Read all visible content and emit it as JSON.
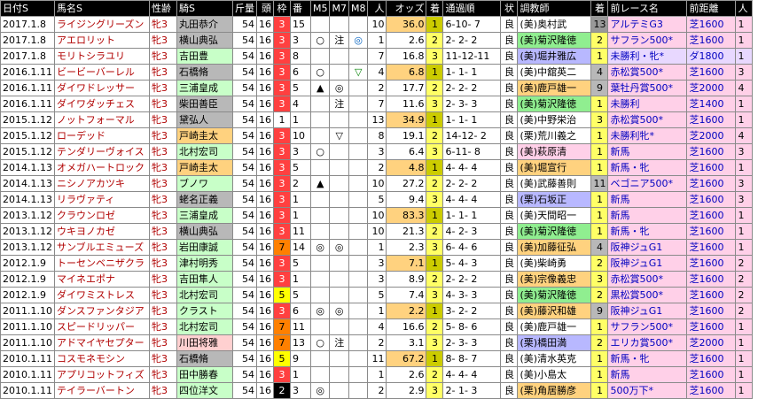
{
  "headers": {
    "date": "日付S",
    "horse": "馬名S",
    "sex": "性齢",
    "jockey": "騎S",
    "weight": "斤量",
    "heads": "頭",
    "frame": "枠",
    "num": "番",
    "m5": "M5",
    "m7": "M7",
    "m8": "M8",
    "pop": "人",
    "odds": "オッズ",
    "fin": "着",
    "passing": "通過順",
    "cond": "状",
    "trainer": "調教師",
    "prev_fin": "着",
    "prev_race": "前レース名",
    "prev_dist": "前距離",
    "prev_pop": "人"
  },
  "rows": [
    {
      "date": "2017.1.8",
      "horse": "ライジングリーズン",
      "sex": "牝3",
      "jockey": "丸田恭介",
      "jockey_bg": "#b8b8b8",
      "weight": "54",
      "heads": "16",
      "frame": "3",
      "frame_bg": "#ff4040",
      "frame_fg": "#fff",
      "num": "15",
      "m5": "",
      "m7": "",
      "m8": "",
      "m8_color": "",
      "pop": "10",
      "odds": "36.0",
      "fin": "1",
      "fin_class": "fin-win",
      "passing": "6-10- 7",
      "cond": "良",
      "trainer": "(美)奥村武",
      "trainer_bg": "",
      "prev_fin": "13",
      "prev_fin_bg": "#999",
      "prev_race": "アルテミG3",
      "prev_dist": "芝1600",
      "prev_pop": "1",
      "prev_bg": "prev-pink"
    },
    {
      "date": "2017.1.8",
      "horse": "アエロリット",
      "sex": "牝3",
      "jockey": "横山典弘",
      "jockey_bg": "#b8b8b8",
      "weight": "54",
      "heads": "16",
      "frame": "3",
      "frame_bg": "#ff4040",
      "frame_fg": "#fff",
      "num": "3",
      "m5": "○",
      "m7": "注",
      "m8": "◎",
      "m8_color": "#0060c0",
      "pop": "1",
      "odds": "2.6",
      "fin": "2",
      "fin_class": "fin-place",
      "passing": "2- 2- 2",
      "cond": "良",
      "trainer": "(美)菊沢隆徳",
      "trainer_bg": "#90ee90",
      "prev_fin": "2",
      "prev_fin_bg": "#ffff66",
      "prev_race": "サフラン500*",
      "prev_dist": "芝1600",
      "prev_pop": "1",
      "prev_bg": "prev-pink"
    },
    {
      "date": "2017.1.8",
      "horse": "モリトシラユリ",
      "sex": "牝3",
      "jockey": "吉田豊",
      "jockey_bg": "#c8ffc8",
      "weight": "54",
      "heads": "16",
      "frame": "3",
      "frame_bg": "#ff4040",
      "frame_fg": "#fff",
      "num": "8",
      "m5": "",
      "m7": "",
      "m8": "",
      "m8_color": "",
      "pop": "7",
      "odds": "16.8",
      "fin": "3",
      "fin_class": "fin-place",
      "passing": "11-12-11",
      "cond": "良",
      "trainer": "(美)堀井雅広",
      "trainer_bg": "#b8b8ff",
      "prev_fin": "1",
      "prev_fin_bg": "#ffff66",
      "prev_race": "未勝利・牝*",
      "prev_dist": "ダ1800",
      "prev_pop": "1",
      "prev_bg": "prev-lav"
    },
    {
      "date": "2016.1.11",
      "horse": "ビービーバーレル",
      "sex": "牝3",
      "jockey": "石橋脩",
      "jockey_bg": "#b8b8b8",
      "weight": "54",
      "heads": "16",
      "frame": "3",
      "frame_bg": "#ff4040",
      "frame_fg": "#fff",
      "num": "6",
      "m5": "○",
      "m7": "",
      "m8": "▽",
      "m8_color": "#008000",
      "pop": "4",
      "odds": "6.8",
      "fin": "1",
      "fin_class": "fin-win",
      "passing": "1- 1- 1",
      "cond": "良",
      "trainer": "(美)中舘英二",
      "trainer_bg": "",
      "prev_fin": "4",
      "prev_fin_bg": "#b8b8b8",
      "prev_race": "赤松賞500*",
      "prev_dist": "芝1600",
      "prev_pop": "3",
      "prev_bg": "prev-pink"
    },
    {
      "date": "2016.1.11",
      "horse": "ダイワドレッサー",
      "sex": "牝3",
      "jockey": "三浦皇成",
      "jockey_bg": "#c8ffc8",
      "weight": "54",
      "heads": "16",
      "frame": "3",
      "frame_bg": "#ff4040",
      "frame_fg": "#fff",
      "num": "5",
      "m5": "▲",
      "m7": "◎",
      "m8": "",
      "m8_color": "",
      "pop": "2",
      "odds": "17.7",
      "fin": "2",
      "fin_class": "fin-place",
      "passing": "2- 2- 2",
      "cond": "良",
      "trainer": "(美)鹿戸雄一",
      "trainer_bg": "#ffd27f",
      "prev_fin": "9",
      "prev_fin_bg": "#b8b8b8",
      "prev_race": "葉牡丹賞500*",
      "prev_dist": "芝2000",
      "prev_pop": "4",
      "prev_bg": "prev-pink"
    },
    {
      "date": "2016.1.11",
      "horse": "ダイワダッチェス",
      "sex": "牝3",
      "jockey": "柴田善臣",
      "jockey_bg": "#b8b8b8",
      "weight": "54",
      "heads": "16",
      "frame": "3",
      "frame_bg": "#ff4040",
      "frame_fg": "#fff",
      "num": "4",
      "m5": "",
      "m7": "注",
      "m8": "",
      "m8_color": "",
      "pop": "7",
      "odds": "11.6",
      "fin": "3",
      "fin_class": "fin-place",
      "passing": "2- 3- 3",
      "cond": "良",
      "trainer": "(美)菊沢隆徳",
      "trainer_bg": "#90ee90",
      "prev_fin": "1",
      "prev_fin_bg": "#ffff66",
      "prev_race": "未勝利",
      "prev_dist": "芝1400",
      "prev_pop": "1",
      "prev_bg": "prev-pink"
    },
    {
      "date": "2015.1.12",
      "horse": "ノットフォーマル",
      "sex": "牝3",
      "jockey": "黛弘人",
      "jockey_bg": "#b8b8b8",
      "weight": "54",
      "heads": "16",
      "frame": "1",
      "frame_bg": "#ffffff",
      "frame_fg": "#000",
      "num": "1",
      "m5": "",
      "m7": "",
      "m8": "",
      "m8_color": "",
      "pop": "13",
      "odds": "34.9",
      "fin": "1",
      "fin_class": "fin-win",
      "passing": "1- 1- 1",
      "cond": "良",
      "trainer": "(美)中野栄治",
      "trainer_bg": "",
      "prev_fin": "3",
      "prev_fin_bg": "#ffff66",
      "prev_race": "赤松賞500*",
      "prev_dist": "芝1600",
      "prev_pop": "1",
      "prev_bg": "prev-pink"
    },
    {
      "date": "2015.1.12",
      "horse": "ローデッド",
      "sex": "牝3",
      "jockey": "戸崎圭太",
      "jockey_bg": "#ffd27f",
      "weight": "54",
      "heads": "16",
      "frame": "3",
      "frame_bg": "#ff4040",
      "frame_fg": "#fff",
      "num": "10",
      "m5": "",
      "m7": "▽",
      "m8": "",
      "m8_color": "",
      "pop": "8",
      "odds": "19.1",
      "fin": "2",
      "fin_class": "fin-place",
      "passing": "14-12- 2",
      "cond": "良",
      "trainer": "(栗)荒川義之",
      "trainer_bg": "",
      "prev_fin": "1",
      "prev_fin_bg": "#ffff66",
      "prev_race": "未勝利牝*",
      "prev_dist": "芝2000",
      "prev_pop": "4",
      "prev_bg": "prev-pink"
    },
    {
      "date": "2015.1.12",
      "horse": "テンダリーヴォイス",
      "sex": "牝3",
      "jockey": "北村宏司",
      "jockey_bg": "#c8ffc8",
      "weight": "54",
      "heads": "16",
      "frame": "3",
      "frame_bg": "#ff4040",
      "frame_fg": "#fff",
      "num": "3",
      "m5": "○",
      "m7": "",
      "m8": "",
      "m8_color": "",
      "pop": "3",
      "odds": "6.4",
      "fin": "3",
      "fin_class": "fin-place",
      "passing": "6-11- 8",
      "cond": "良",
      "trainer": "(美)萩原清",
      "trainer_bg": "#ffd0e8",
      "prev_fin": "1",
      "prev_fin_bg": "#ffff66",
      "prev_race": "新馬",
      "prev_dist": "芝1600",
      "prev_pop": "3",
      "prev_bg": "prev-pink"
    },
    {
      "date": "2014.1.13",
      "horse": "オメガハートロック",
      "sex": "牝3",
      "jockey": "戸崎圭太",
      "jockey_bg": "#ffd27f",
      "weight": "54",
      "heads": "16",
      "frame": "3",
      "frame_bg": "#ff4040",
      "frame_fg": "#fff",
      "num": "5",
      "m5": "",
      "m7": "",
      "m8": "",
      "m8_color": "",
      "pop": "2",
      "odds": "4.8",
      "fin": "1",
      "fin_class": "fin-win",
      "passing": "4- 4- 4",
      "cond": "良",
      "trainer": "(美)堀宣行",
      "trainer_bg": "#ffd27f",
      "prev_fin": "1",
      "prev_fin_bg": "#ffff66",
      "prev_race": "新馬・牝",
      "prev_dist": "芝1600",
      "prev_pop": "1",
      "prev_bg": "prev-pink"
    },
    {
      "date": "2014.1.13",
      "horse": "ニシノアカツキ",
      "sex": "牝3",
      "jockey": "ブノワ",
      "jockey_bg": "#c8ffc8",
      "weight": "54",
      "heads": "16",
      "frame": "3",
      "frame_bg": "#ff4040",
      "frame_fg": "#fff",
      "num": "2",
      "m5": "▲",
      "m7": "",
      "m8": "",
      "m8_color": "",
      "pop": "10",
      "odds": "27.2",
      "fin": "2",
      "fin_class": "fin-place",
      "passing": "2- 2- 2",
      "cond": "良",
      "trainer": "(美)武藤善則",
      "trainer_bg": "",
      "prev_fin": "11",
      "prev_fin_bg": "#b8b8b8",
      "prev_race": "ベゴニア500*",
      "prev_dist": "芝1600",
      "prev_pop": "3",
      "prev_bg": "prev-pink"
    },
    {
      "date": "2014.1.13",
      "horse": "リラヴァティ",
      "sex": "牝3",
      "jockey": "蛯名正義",
      "jockey_bg": "#b8b8b8",
      "weight": "54",
      "heads": "16",
      "frame": "3",
      "frame_bg": "#ff4040",
      "frame_fg": "#fff",
      "num": "1",
      "m5": "",
      "m7": "",
      "m8": "",
      "m8_color": "",
      "pop": "5",
      "odds": "9.4",
      "fin": "3",
      "fin_class": "fin-place",
      "passing": "4- 4- 4",
      "cond": "良",
      "trainer": "(栗)石坂正",
      "trainer_bg": "#b8b8ff",
      "prev_fin": "1",
      "prev_fin_bg": "#ffff66",
      "prev_race": "新馬",
      "prev_dist": "芝1600",
      "prev_pop": "3",
      "prev_bg": "prev-pink"
    },
    {
      "date": "2013.1.12",
      "horse": "クラウンロゼ",
      "sex": "牝3",
      "jockey": "三浦皇成",
      "jockey_bg": "#c8ffc8",
      "weight": "54",
      "heads": "16",
      "frame": "3",
      "frame_bg": "#ff4040",
      "frame_fg": "#fff",
      "num": "1",
      "m5": "",
      "m7": "",
      "m8": "",
      "m8_color": "",
      "pop": "10",
      "odds": "83.3",
      "fin": "1",
      "fin_class": "fin-win",
      "passing": "1- 1- 1",
      "cond": "良",
      "trainer": "(美)天間昭一",
      "trainer_bg": "",
      "prev_fin": "1",
      "prev_fin_bg": "#ffff66",
      "prev_race": "新馬",
      "prev_dist": "芝1600",
      "prev_pop": "1",
      "prev_bg": "prev-pink"
    },
    {
      "date": "2013.1.12",
      "horse": "ウキヨノカゼ",
      "sex": "牝3",
      "jockey": "横山典弘",
      "jockey_bg": "#b8b8b8",
      "weight": "54",
      "heads": "16",
      "frame": "3",
      "frame_bg": "#ff4040",
      "frame_fg": "#fff",
      "num": "11",
      "m5": "",
      "m7": "",
      "m8": "",
      "m8_color": "",
      "pop": "10",
      "odds": "21.3",
      "fin": "2",
      "fin_class": "fin-place",
      "passing": "4- 2- 3",
      "cond": "良",
      "trainer": "(美)菊沢隆徳",
      "trainer_bg": "#90ee90",
      "prev_fin": "1",
      "prev_fin_bg": "#ffff66",
      "prev_race": "新馬・牝",
      "prev_dist": "芝1600",
      "prev_pop": "1",
      "prev_bg": "prev-pink"
    },
    {
      "date": "2013.1.12",
      "horse": "サンブルエミューズ",
      "sex": "牝3",
      "jockey": "岩田康誠",
      "jockey_bg": "#c8ffc8",
      "weight": "54",
      "heads": "16",
      "frame": "7",
      "frame_bg": "#ff8000",
      "frame_fg": "#000",
      "num": "14",
      "m5": "◎",
      "m7": "◎",
      "m8": "",
      "m8_color": "",
      "pop": "1",
      "odds": "2.3",
      "fin": "3",
      "fin_class": "fin-place",
      "passing": "6- 4- 6",
      "cond": "良",
      "trainer": "(美)加藤征弘",
      "trainer_bg": "#ffd27f",
      "prev_fin": "4",
      "prev_fin_bg": "#b8b8b8",
      "prev_race": "阪神ジュG1",
      "prev_dist": "芝1600",
      "prev_pop": "1",
      "prev_bg": "prev-pink"
    },
    {
      "date": "2012.1.9",
      "horse": "トーセンベニザクラ",
      "sex": "牝3",
      "jockey": "津村明秀",
      "jockey_bg": "#c8ffc8",
      "weight": "54",
      "heads": "16",
      "frame": "3",
      "frame_bg": "#ff4040",
      "frame_fg": "#fff",
      "num": "5",
      "m5": "",
      "m7": "",
      "m8": "",
      "m8_color": "",
      "pop": "3",
      "odds": "7.1",
      "fin": "1",
      "fin_class": "fin-win",
      "passing": "5- 4- 3",
      "cond": "良",
      "trainer": "(美)柴崎勇",
      "trainer_bg": "",
      "prev_fin": "2",
      "prev_fin_bg": "#ffff66",
      "prev_race": "阪神ジュG1",
      "prev_dist": "芝1600",
      "prev_pop": "2",
      "prev_bg": "prev-pink"
    },
    {
      "date": "2012.1.9",
      "horse": "マイネエポナ",
      "sex": "牝3",
      "jockey": "吉田隼人",
      "jockey_bg": "#c8ffc8",
      "weight": "54",
      "heads": "16",
      "frame": "3",
      "frame_bg": "#ff4040",
      "frame_fg": "#fff",
      "num": "1",
      "m5": "",
      "m7": "",
      "m8": "",
      "m8_color": "",
      "pop": "3",
      "odds": "8.9",
      "fin": "2",
      "fin_class": "fin-place",
      "passing": "2- 2- 2",
      "cond": "良",
      "trainer": "(美)宗像義忠",
      "trainer_bg": "#ffd27f",
      "prev_fin": "3",
      "prev_fin_bg": "#ffff66",
      "prev_race": "赤松賞500*",
      "prev_dist": "芝1600",
      "prev_pop": "2",
      "prev_bg": "prev-pink"
    },
    {
      "date": "2012.1.9",
      "horse": "ダイワミストレス",
      "sex": "牝3",
      "jockey": "北村宏司",
      "jockey_bg": "#c8ffc8",
      "weight": "54",
      "heads": "16",
      "frame": "5",
      "frame_bg": "#ffff00",
      "frame_fg": "#000",
      "num": "5",
      "m5": "",
      "m7": "",
      "m8": "",
      "m8_color": "",
      "pop": "5",
      "odds": "7.4",
      "fin": "3",
      "fin_class": "fin-place",
      "passing": "4- 3- 3",
      "cond": "良",
      "trainer": "(美)菊沢隆徳",
      "trainer_bg": "#90ee90",
      "prev_fin": "2",
      "prev_fin_bg": "#ffff66",
      "prev_race": "黒松賞500*",
      "prev_dist": "芝1600",
      "prev_pop": "2",
      "prev_bg": "prev-pink"
    },
    {
      "date": "2011.1.10",
      "horse": "ダンスファンタジア",
      "sex": "牝3",
      "jockey": "クラスト",
      "jockey_bg": "#c8ffc8",
      "weight": "54",
      "heads": "16",
      "frame": "3",
      "frame_bg": "#ff4040",
      "frame_fg": "#fff",
      "num": "6",
      "m5": "◎",
      "m7": "◎",
      "m8": "",
      "m8_color": "",
      "pop": "1",
      "odds": "2.2",
      "fin": "1",
      "fin_class": "fin-win",
      "passing": "3- 2- 2",
      "cond": "良",
      "trainer": "(美)藤沢和雄",
      "trainer_bg": "#ffd27f",
      "prev_fin": "9",
      "prev_fin_bg": "#b8b8b8",
      "prev_race": "阪神ジュG1",
      "prev_dist": "芝1600",
      "prev_pop": "2",
      "prev_bg": "prev-pink"
    },
    {
      "date": "2011.1.10",
      "horse": "スピードリッパー",
      "sex": "牝3",
      "jockey": "北村宏司",
      "jockey_bg": "#c8ffc8",
      "weight": "54",
      "heads": "16",
      "frame": "7",
      "frame_bg": "#ff8000",
      "frame_fg": "#000",
      "num": "11",
      "m5": "",
      "m7": "",
      "m8": "",
      "m8_color": "",
      "pop": "4",
      "odds": "16.6",
      "fin": "2",
      "fin_class": "fin-place",
      "passing": "5- 8- 6",
      "cond": "良",
      "trainer": "(美)鹿戸雄一",
      "trainer_bg": "",
      "prev_fin": "1",
      "prev_fin_bg": "#ffff66",
      "prev_race": "サフラン500*",
      "prev_dist": "芝1600",
      "prev_pop": "1",
      "prev_bg": "prev-pink"
    },
    {
      "date": "2011.1.10",
      "horse": "アドマイヤセプター",
      "sex": "牝3",
      "jockey": "川田将雅",
      "jockey_bg": "#ffd0d0",
      "weight": "54",
      "heads": "16",
      "frame": "7",
      "frame_bg": "#ff8000",
      "frame_fg": "#000",
      "num": "13",
      "m5": "○",
      "m7": "注",
      "m8": "",
      "m8_color": "",
      "pop": "2",
      "odds": "3.1",
      "fin": "3",
      "fin_class": "fin-place",
      "passing": "2- 3- 3",
      "cond": "良",
      "trainer": "(栗)橋田満",
      "trainer_bg": "#b8b8ff",
      "prev_fin": "2",
      "prev_fin_bg": "#ffff66",
      "prev_race": "エリカ賞500*",
      "prev_dist": "芝2000",
      "prev_pop": "1",
      "prev_bg": "prev-pink"
    },
    {
      "date": "2010.1.11",
      "horse": "コスモネモシン",
      "sex": "牝3",
      "jockey": "石橋脩",
      "jockey_bg": "#b8b8b8",
      "weight": "54",
      "heads": "16",
      "frame": "5",
      "frame_bg": "#ffff00",
      "frame_fg": "#000",
      "num": "9",
      "m5": "",
      "m7": "",
      "m8": "",
      "m8_color": "",
      "pop": "11",
      "odds": "67.2",
      "fin": "1",
      "fin_class": "fin-win",
      "passing": "8- 8- 7",
      "cond": "良",
      "trainer": "(美)清水英克",
      "trainer_bg": "",
      "prev_fin": "1",
      "prev_fin_bg": "#ffff66",
      "prev_race": "新馬・牝",
      "prev_dist": "芝1600",
      "prev_pop": "1",
      "prev_bg": "prev-pink"
    },
    {
      "date": "2010.1.11",
      "horse": "アプリコットフィズ",
      "sex": "牝3",
      "jockey": "田中勝春",
      "jockey_bg": "#c8ffc8",
      "weight": "54",
      "heads": "16",
      "frame": "3",
      "frame_bg": "#ff4040",
      "frame_fg": "#fff",
      "num": "1",
      "m5": "",
      "m7": "",
      "m8": "",
      "m8_color": "",
      "pop": "1",
      "odds": "2.6",
      "fin": "2",
      "fin_class": "fin-place",
      "passing": "4- 4- 4",
      "cond": "良",
      "trainer": "(美)小島太",
      "trainer_bg": "",
      "prev_fin": "1",
      "prev_fin_bg": "#ffff66",
      "prev_race": "新馬",
      "prev_dist": "芝1600",
      "prev_pop": "1",
      "prev_bg": "prev-pink"
    },
    {
      "date": "2010.1.11",
      "horse": "テイラーバートン",
      "sex": "牝3",
      "jockey": "四位洋文",
      "jockey_bg": "#c8ffc8",
      "weight": "54",
      "heads": "16",
      "frame": "2",
      "frame_bg": "#000000",
      "frame_fg": "#fff",
      "num": "3",
      "m5": "◎",
      "m7": "",
      "m8": "",
      "m8_color": "",
      "pop": "2",
      "odds": "2.9",
      "fin": "3",
      "fin_class": "fin-place",
      "passing": "2- 1- 3",
      "cond": "良",
      "trainer": "(栗)角居勝彦",
      "trainer_bg": "#ffd27f",
      "prev_fin": "1",
      "prev_fin_bg": "#ffff66",
      "prev_race": "500万下*",
      "prev_dist": "芝1600",
      "prev_pop": "1",
      "prev_bg": "prev-pink"
    }
  ]
}
